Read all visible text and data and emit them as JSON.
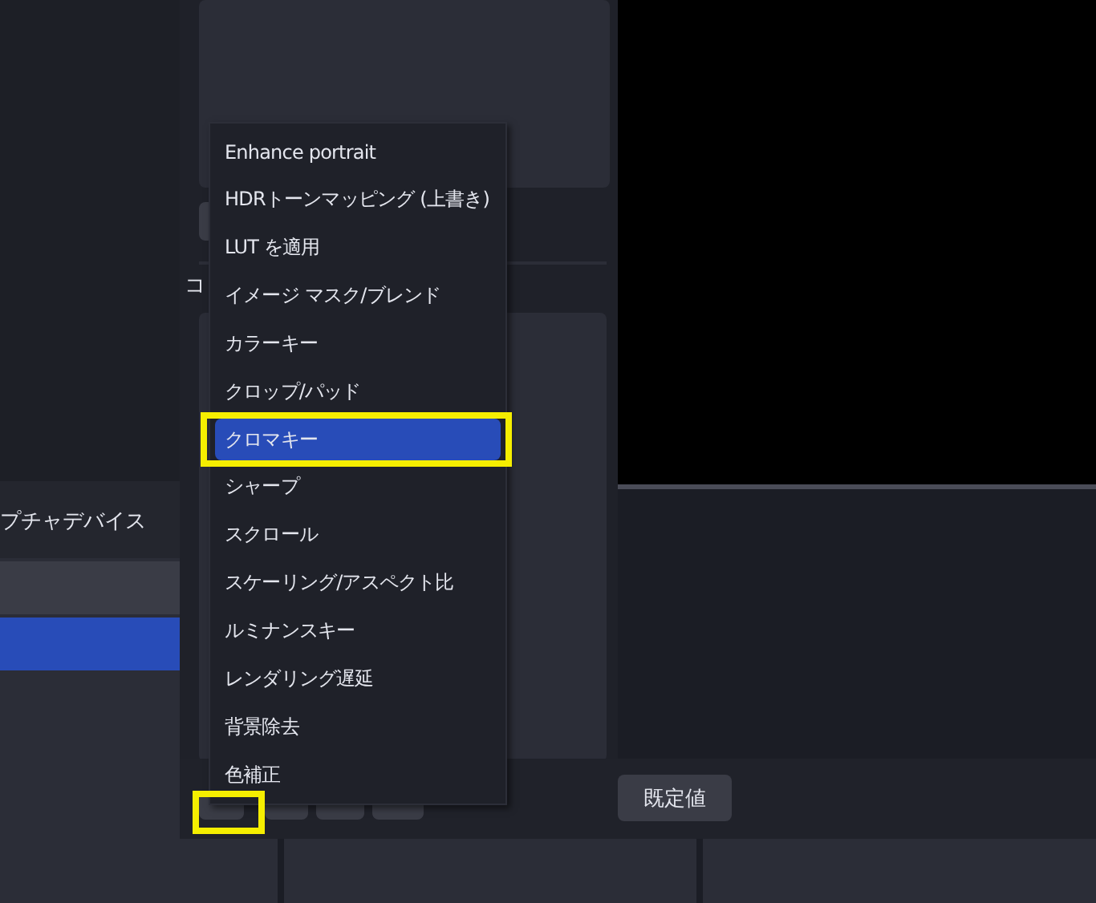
{
  "sources_panel": {
    "header": "プチャデバイス",
    "rows": [
      {
        "selected": false
      },
      {
        "selected": true
      }
    ]
  },
  "filters_dialog": {
    "section_label": "コ",
    "default_button": "既定値"
  },
  "filter_menu": {
    "items": [
      {
        "label": "Enhance portrait",
        "selected": false
      },
      {
        "label": "HDRトーンマッピング (上書き)",
        "selected": false
      },
      {
        "label": "LUT を適用",
        "selected": false
      },
      {
        "label": "イメージ マスク/ブレンド",
        "selected": false
      },
      {
        "label": "カラーキー",
        "selected": false
      },
      {
        "label": "クロップ/パッド",
        "selected": false
      },
      {
        "label": "クロマキー",
        "selected": true
      },
      {
        "label": "シャープ",
        "selected": false
      },
      {
        "label": "スクロール",
        "selected": false
      },
      {
        "label": "スケーリング/アスペクト比",
        "selected": false
      },
      {
        "label": "ルミナンスキー",
        "selected": false
      },
      {
        "label": "レンダリング遅延",
        "selected": false
      },
      {
        "label": "背景除去",
        "selected": false
      },
      {
        "label": "色補正",
        "selected": false
      }
    ]
  }
}
